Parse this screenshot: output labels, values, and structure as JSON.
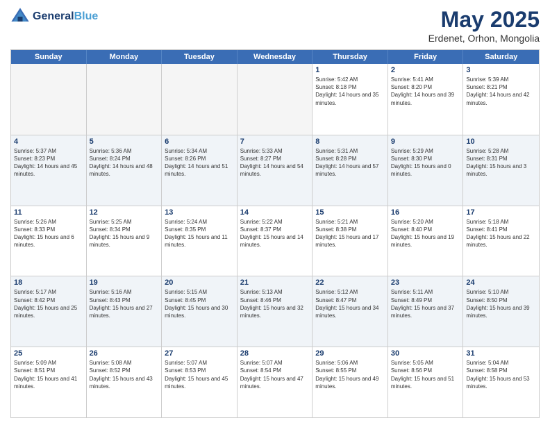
{
  "header": {
    "logo_line1": "General",
    "logo_line2": "Blue",
    "month": "May 2025",
    "location": "Erdenet, Orhon, Mongolia"
  },
  "weekdays": [
    "Sunday",
    "Monday",
    "Tuesday",
    "Wednesday",
    "Thursday",
    "Friday",
    "Saturday"
  ],
  "rows": [
    [
      {
        "day": "",
        "empty": true
      },
      {
        "day": "",
        "empty": true
      },
      {
        "day": "",
        "empty": true
      },
      {
        "day": "",
        "empty": true
      },
      {
        "day": "1",
        "sunrise": "Sunrise: 5:42 AM",
        "sunset": "Sunset: 8:18 PM",
        "daylight": "Daylight: 14 hours and 35 minutes."
      },
      {
        "day": "2",
        "sunrise": "Sunrise: 5:41 AM",
        "sunset": "Sunset: 8:20 PM",
        "daylight": "Daylight: 14 hours and 39 minutes."
      },
      {
        "day": "3",
        "sunrise": "Sunrise: 5:39 AM",
        "sunset": "Sunset: 8:21 PM",
        "daylight": "Daylight: 14 hours and 42 minutes."
      }
    ],
    [
      {
        "day": "4",
        "sunrise": "Sunrise: 5:37 AM",
        "sunset": "Sunset: 8:23 PM",
        "daylight": "Daylight: 14 hours and 45 minutes."
      },
      {
        "day": "5",
        "sunrise": "Sunrise: 5:36 AM",
        "sunset": "Sunset: 8:24 PM",
        "daylight": "Daylight: 14 hours and 48 minutes."
      },
      {
        "day": "6",
        "sunrise": "Sunrise: 5:34 AM",
        "sunset": "Sunset: 8:26 PM",
        "daylight": "Daylight: 14 hours and 51 minutes."
      },
      {
        "day": "7",
        "sunrise": "Sunrise: 5:33 AM",
        "sunset": "Sunset: 8:27 PM",
        "daylight": "Daylight: 14 hours and 54 minutes."
      },
      {
        "day": "8",
        "sunrise": "Sunrise: 5:31 AM",
        "sunset": "Sunset: 8:28 PM",
        "daylight": "Daylight: 14 hours and 57 minutes."
      },
      {
        "day": "9",
        "sunrise": "Sunrise: 5:29 AM",
        "sunset": "Sunset: 8:30 PM",
        "daylight": "Daylight: 15 hours and 0 minutes."
      },
      {
        "day": "10",
        "sunrise": "Sunrise: 5:28 AM",
        "sunset": "Sunset: 8:31 PM",
        "daylight": "Daylight: 15 hours and 3 minutes."
      }
    ],
    [
      {
        "day": "11",
        "sunrise": "Sunrise: 5:26 AM",
        "sunset": "Sunset: 8:33 PM",
        "daylight": "Daylight: 15 hours and 6 minutes."
      },
      {
        "day": "12",
        "sunrise": "Sunrise: 5:25 AM",
        "sunset": "Sunset: 8:34 PM",
        "daylight": "Daylight: 15 hours and 9 minutes."
      },
      {
        "day": "13",
        "sunrise": "Sunrise: 5:24 AM",
        "sunset": "Sunset: 8:35 PM",
        "daylight": "Daylight: 15 hours and 11 minutes."
      },
      {
        "day": "14",
        "sunrise": "Sunrise: 5:22 AM",
        "sunset": "Sunset: 8:37 PM",
        "daylight": "Daylight: 15 hours and 14 minutes."
      },
      {
        "day": "15",
        "sunrise": "Sunrise: 5:21 AM",
        "sunset": "Sunset: 8:38 PM",
        "daylight": "Daylight: 15 hours and 17 minutes."
      },
      {
        "day": "16",
        "sunrise": "Sunrise: 5:20 AM",
        "sunset": "Sunset: 8:40 PM",
        "daylight": "Daylight: 15 hours and 19 minutes."
      },
      {
        "day": "17",
        "sunrise": "Sunrise: 5:18 AM",
        "sunset": "Sunset: 8:41 PM",
        "daylight": "Daylight: 15 hours and 22 minutes."
      }
    ],
    [
      {
        "day": "18",
        "sunrise": "Sunrise: 5:17 AM",
        "sunset": "Sunset: 8:42 PM",
        "daylight": "Daylight: 15 hours and 25 minutes."
      },
      {
        "day": "19",
        "sunrise": "Sunrise: 5:16 AM",
        "sunset": "Sunset: 8:43 PM",
        "daylight": "Daylight: 15 hours and 27 minutes."
      },
      {
        "day": "20",
        "sunrise": "Sunrise: 5:15 AM",
        "sunset": "Sunset: 8:45 PM",
        "daylight": "Daylight: 15 hours and 30 minutes."
      },
      {
        "day": "21",
        "sunrise": "Sunrise: 5:13 AM",
        "sunset": "Sunset: 8:46 PM",
        "daylight": "Daylight: 15 hours and 32 minutes."
      },
      {
        "day": "22",
        "sunrise": "Sunrise: 5:12 AM",
        "sunset": "Sunset: 8:47 PM",
        "daylight": "Daylight: 15 hours and 34 minutes."
      },
      {
        "day": "23",
        "sunrise": "Sunrise: 5:11 AM",
        "sunset": "Sunset: 8:49 PM",
        "daylight": "Daylight: 15 hours and 37 minutes."
      },
      {
        "day": "24",
        "sunrise": "Sunrise: 5:10 AM",
        "sunset": "Sunset: 8:50 PM",
        "daylight": "Daylight: 15 hours and 39 minutes."
      }
    ],
    [
      {
        "day": "25",
        "sunrise": "Sunrise: 5:09 AM",
        "sunset": "Sunset: 8:51 PM",
        "daylight": "Daylight: 15 hours and 41 minutes."
      },
      {
        "day": "26",
        "sunrise": "Sunrise: 5:08 AM",
        "sunset": "Sunset: 8:52 PM",
        "daylight": "Daylight: 15 hours and 43 minutes."
      },
      {
        "day": "27",
        "sunrise": "Sunrise: 5:07 AM",
        "sunset": "Sunset: 8:53 PM",
        "daylight": "Daylight: 15 hours and 45 minutes."
      },
      {
        "day": "28",
        "sunrise": "Sunrise: 5:07 AM",
        "sunset": "Sunset: 8:54 PM",
        "daylight": "Daylight: 15 hours and 47 minutes."
      },
      {
        "day": "29",
        "sunrise": "Sunrise: 5:06 AM",
        "sunset": "Sunset: 8:55 PM",
        "daylight": "Daylight: 15 hours and 49 minutes."
      },
      {
        "day": "30",
        "sunrise": "Sunrise: 5:05 AM",
        "sunset": "Sunset: 8:56 PM",
        "daylight": "Daylight: 15 hours and 51 minutes."
      },
      {
        "day": "31",
        "sunrise": "Sunrise: 5:04 AM",
        "sunset": "Sunset: 8:58 PM",
        "daylight": "Daylight: 15 hours and 53 minutes."
      }
    ]
  ]
}
